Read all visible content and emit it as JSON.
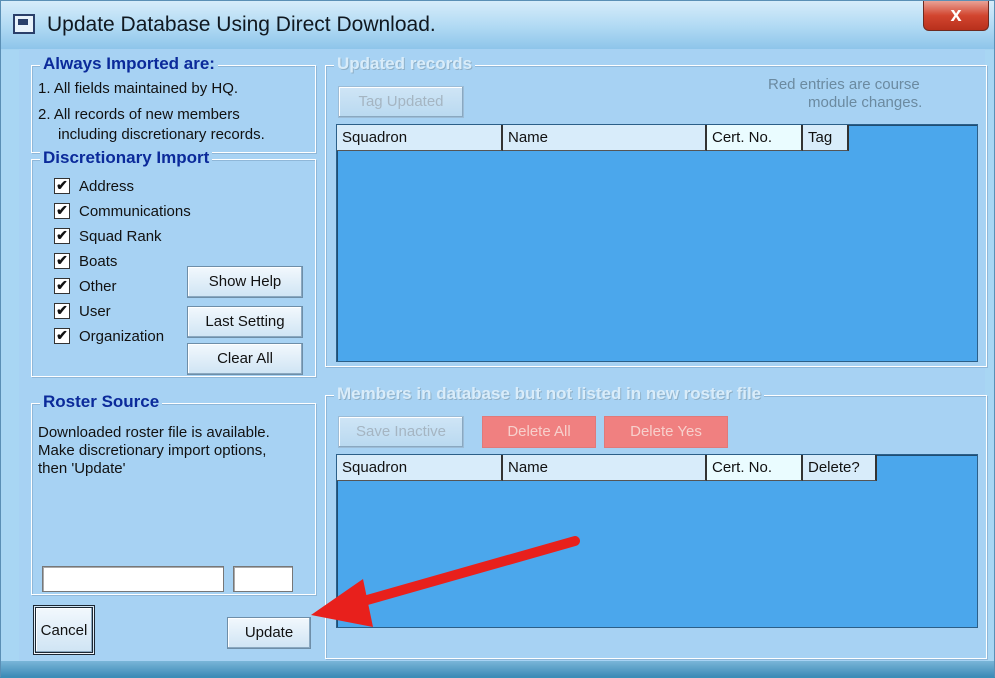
{
  "window": {
    "title": "Update Database Using Direct Download.",
    "close_label": "x"
  },
  "always_imported": {
    "legend": "Always Imported are:",
    "line1": "1. All fields maintained by HQ.",
    "line2": "2. All records of new members",
    "line3": "including discretionary records."
  },
  "discretionary": {
    "legend": "Discretionary Import",
    "items": [
      {
        "label": "Address",
        "checked": true
      },
      {
        "label": "Communications",
        "checked": true
      },
      {
        "label": "Squad Rank",
        "checked": true
      },
      {
        "label": "Boats",
        "checked": true
      },
      {
        "label": "Other",
        "checked": true
      },
      {
        "label": "User",
        "checked": true
      },
      {
        "label": "Organization",
        "checked": true
      }
    ],
    "show_help": "Show Help",
    "last_setting": "Last Setting",
    "clear_all": "Clear All",
    "check_mark": "✔"
  },
  "roster": {
    "legend": "Roster Source",
    "line1": "Downloaded roster file is available.",
    "line2": "Make discretionary import options,",
    "line3": "then 'Update'",
    "field1_value": "",
    "field2_value": ""
  },
  "buttons": {
    "cancel": "Cancel",
    "update": "Update"
  },
  "updated": {
    "legend": "Updated records",
    "tag_updated": "Tag Updated",
    "note_line1": "Red entries are course",
    "note_line2": "module changes.",
    "columns": [
      "Squadron",
      "Name",
      "Cert. No.",
      "Tag"
    ]
  },
  "members": {
    "legend": "Members in database but not listed in new roster file",
    "save_inactive": "Save Inactive",
    "delete_all": "Delete All",
    "delete_yes": "Delete Yes",
    "columns": [
      "Squadron",
      "Name",
      "Cert. No.",
      "Delete?"
    ]
  },
  "colors": {
    "accent_red": "#e8201c",
    "legend_blue": "#0b2a9a",
    "list_blue": "#4ba7ec"
  }
}
